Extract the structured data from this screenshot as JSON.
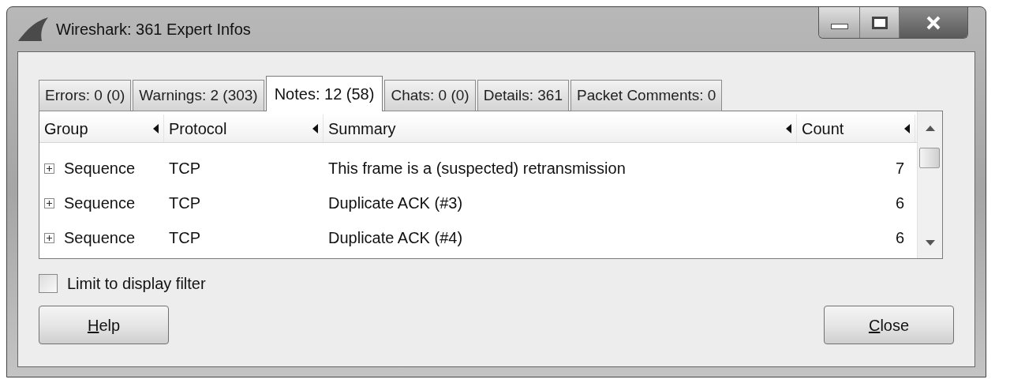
{
  "window": {
    "title": "Wireshark: 361 Expert Infos"
  },
  "tabs": [
    {
      "label": "Errors: 0 (0)",
      "selected": false
    },
    {
      "label": "Warnings: 2 (303)",
      "selected": false
    },
    {
      "label": "Notes: 12 (58)",
      "selected": true
    },
    {
      "label": "Chats: 0 (0)",
      "selected": false
    },
    {
      "label": "Details: 361",
      "selected": false
    },
    {
      "label": "Packet Comments: 0",
      "selected": false
    }
  ],
  "table": {
    "columns": [
      "Group",
      "Protocol",
      "Summary",
      "Count"
    ],
    "rows": [
      {
        "expanded": false,
        "cells": [
          "Sequence",
          "TCP",
          "This frame is a (suspected) retransmission",
          "7"
        ]
      },
      {
        "expanded": false,
        "cells": [
          "Sequence",
          "TCP",
          "Duplicate ACK (#3)",
          "6"
        ]
      },
      {
        "expanded": false,
        "cells": [
          "Sequence",
          "TCP",
          "Duplicate ACK (#4)",
          "6"
        ]
      }
    ]
  },
  "limit_checkbox": {
    "label": "Limit to display filter",
    "checked": false
  },
  "buttons": [
    "Help",
    "Close"
  ]
}
